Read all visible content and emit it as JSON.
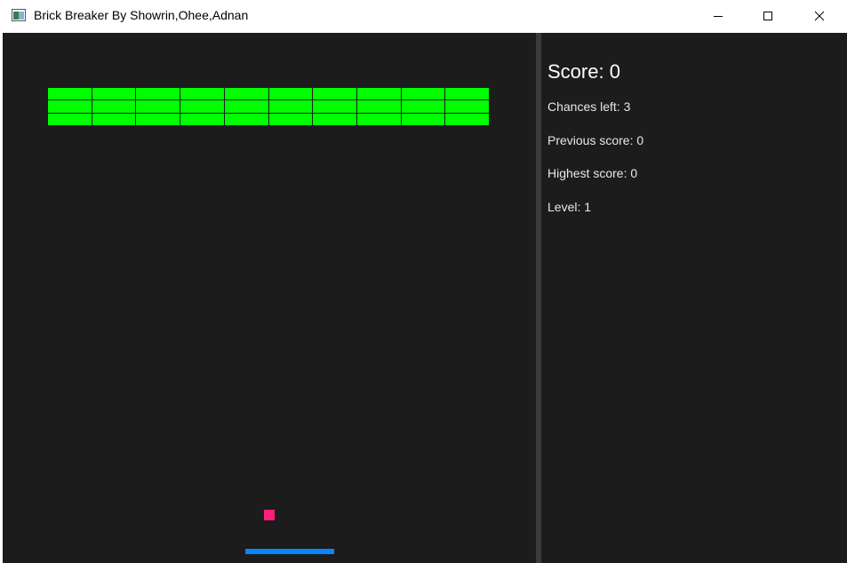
{
  "window": {
    "title": "Brick Breaker By Showrin,Ohee,Adnan"
  },
  "colors": {
    "background": "#1c1c1c",
    "brick": "#00ff00",
    "ball": "#ff1f7a",
    "paddle": "#0a84ff"
  },
  "game": {
    "brick_rows": 3,
    "brick_columns": 10
  },
  "panel": {
    "score": "Score: 0",
    "chances": "Chances left: 3",
    "previous": "Previous score: 0",
    "highest": "Highest score: 0",
    "level": "Level: 1"
  }
}
